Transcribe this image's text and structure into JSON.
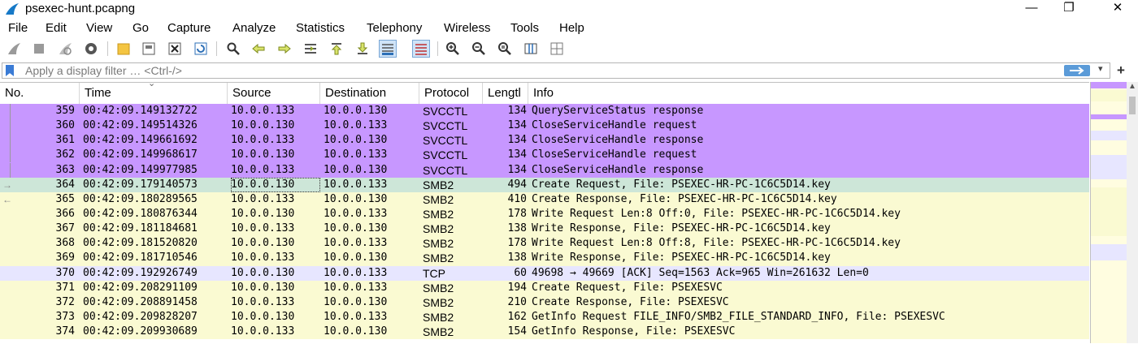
{
  "window": {
    "title": "psexec-hunt.pcapng",
    "minimize_label": "—",
    "restore_label": "❐",
    "close_label": "✕"
  },
  "menu": [
    "File",
    "Edit",
    "View",
    "Go",
    "Capture",
    "Analyze",
    "Statistics",
    "Telephony",
    "Wireless",
    "Tools",
    "Help"
  ],
  "toolbar_icons": [
    "start-capture-icon",
    "stop-capture-icon",
    "restart-capture-icon",
    "capture-options-icon",
    "open-file-icon",
    "save-file-icon",
    "close-file-icon",
    "reload-file-icon",
    "find-packet-icon",
    "go-back-icon",
    "go-forward-icon",
    "go-to-packet-icon",
    "go-first-icon",
    "go-last-icon",
    "autoscroll-icon",
    "colorize-icon",
    "zoom-in-icon",
    "zoom-out-icon",
    "normal-size-icon",
    "resize-columns-icon",
    "expand-subtrees-icon"
  ],
  "filter": {
    "placeholder": "Apply a display filter … <Ctrl-/>",
    "value": ""
  },
  "columns": {
    "no": "No.",
    "time": "Time",
    "source": "Source",
    "destination": "Destination",
    "protocol": "Protocol",
    "length": "Lengtl",
    "info": "Info"
  },
  "colors": {
    "svcctl_row": "#c797ff",
    "smb2_row": "#fafad2",
    "tcp_row": "#e7e6ff",
    "selected_row": "#cde6d8"
  },
  "packets": [
    {
      "no": "359",
      "time": "00:42:09.149132722",
      "src": "10.0.0.133",
      "dst": "10.0.0.130",
      "proto": "SVCCTL",
      "len": "134",
      "info": "QueryServiceStatus response",
      "color": "#c797ff"
    },
    {
      "no": "360",
      "time": "00:42:09.149514326",
      "src": "10.0.0.130",
      "dst": "10.0.0.133",
      "proto": "SVCCTL",
      "len": "134",
      "info": "CloseServiceHandle request",
      "color": "#c797ff"
    },
    {
      "no": "361",
      "time": "00:42:09.149661692",
      "src": "10.0.0.133",
      "dst": "10.0.0.130",
      "proto": "SVCCTL",
      "len": "134",
      "info": "CloseServiceHandle response",
      "color": "#c797ff"
    },
    {
      "no": "362",
      "time": "00:42:09.149968617",
      "src": "10.0.0.130",
      "dst": "10.0.0.133",
      "proto": "SVCCTL",
      "len": "134",
      "info": "CloseServiceHandle request",
      "color": "#c797ff"
    },
    {
      "no": "363",
      "time": "00:42:09.149977985",
      "src": "10.0.0.133",
      "dst": "10.0.0.130",
      "proto": "SVCCTL",
      "len": "134",
      "info": "CloseServiceHandle response",
      "color": "#c797ff"
    },
    {
      "no": "364",
      "time": "00:42:09.179140573",
      "src": "10.0.0.130",
      "dst": "10.0.0.133",
      "proto": "SMB2",
      "len": "494",
      "info": "Create Request, File: PSEXEC-HR-PC-1C6C5D14.key",
      "color": "#cde6d8"
    },
    {
      "no": "365",
      "time": "00:42:09.180289565",
      "src": "10.0.0.133",
      "dst": "10.0.0.130",
      "proto": "SMB2",
      "len": "410",
      "info": "Create Response, File: PSEXEC-HR-PC-1C6C5D14.key",
      "color": "#fafad2"
    },
    {
      "no": "366",
      "time": "00:42:09.180876344",
      "src": "10.0.0.130",
      "dst": "10.0.0.133",
      "proto": "SMB2",
      "len": "178",
      "info": "Write Request Len:8 Off:0, File: PSEXEC-HR-PC-1C6C5D14.key",
      "color": "#fafad2"
    },
    {
      "no": "367",
      "time": "00:42:09.181184681",
      "src": "10.0.0.133",
      "dst": "10.0.0.130",
      "proto": "SMB2",
      "len": "138",
      "info": "Write Response, File: PSEXEC-HR-PC-1C6C5D14.key",
      "color": "#fafad2"
    },
    {
      "no": "368",
      "time": "00:42:09.181520820",
      "src": "10.0.0.130",
      "dst": "10.0.0.133",
      "proto": "SMB2",
      "len": "178",
      "info": "Write Request Len:8 Off:8, File: PSEXEC-HR-PC-1C6C5D14.key",
      "color": "#fafad2"
    },
    {
      "no": "369",
      "time": "00:42:09.181710546",
      "src": "10.0.0.133",
      "dst": "10.0.0.130",
      "proto": "SMB2",
      "len": "138",
      "info": "Write Response, File: PSEXEC-HR-PC-1C6C5D14.key",
      "color": "#fafad2"
    },
    {
      "no": "370",
      "time": "00:42:09.192926749",
      "src": "10.0.0.130",
      "dst": "10.0.0.133",
      "proto": "TCP",
      "len": "60",
      "info": "49698 → 49669 [ACK] Seq=1563 Ack=965 Win=261632 Len=0",
      "color": "#e7e6ff"
    },
    {
      "no": "371",
      "time": "00:42:09.208291109",
      "src": "10.0.0.130",
      "dst": "10.0.0.133",
      "proto": "SMB2",
      "len": "194",
      "info": "Create Request, File: PSEXESVC",
      "color": "#fafad2"
    },
    {
      "no": "372",
      "time": "00:42:09.208891458",
      "src": "10.0.0.133",
      "dst": "10.0.0.130",
      "proto": "SMB2",
      "len": "210",
      "info": "Create Response, File: PSEXESVC",
      "color": "#fafad2"
    },
    {
      "no": "373",
      "time": "00:42:09.209828207",
      "src": "10.0.0.130",
      "dst": "10.0.0.133",
      "proto": "SMB2",
      "len": "162",
      "info": "GetInfo Request FILE_INFO/SMB2_FILE_STANDARD_INFO, File: PSEXESVC",
      "color": "#fafad2"
    },
    {
      "no": "374",
      "time": "00:42:09.209930689",
      "src": "10.0.0.133",
      "dst": "10.0.0.130",
      "proto": "SMB2",
      "len": "154",
      "info": "GetInfo Response, File: PSEXESVC",
      "color": "#fafad2"
    }
  ],
  "selected_packet": "364"
}
